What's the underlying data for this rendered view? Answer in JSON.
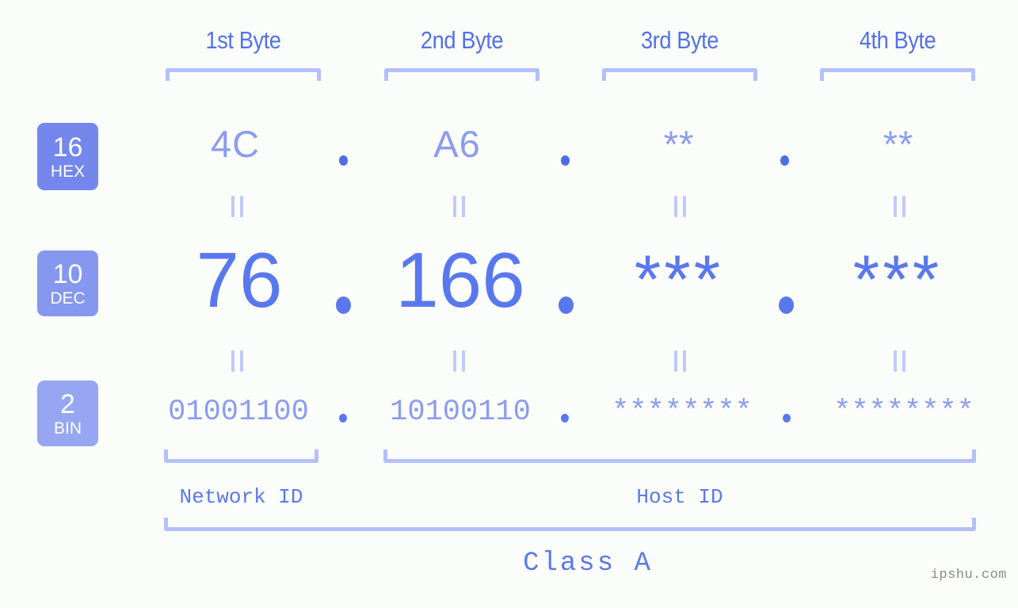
{
  "watermark": "ipshu.com",
  "class_label": "Class A",
  "byte_headers": [
    {
      "label": "1st Byte"
    },
    {
      "label": "2nd Byte"
    },
    {
      "label": "3rd Byte"
    },
    {
      "label": "4th Byte"
    }
  ],
  "bases": [
    {
      "id": "hex",
      "number": "16",
      "name": "HEX",
      "color": "#7387ec"
    },
    {
      "id": "dec",
      "number": "10",
      "name": "DEC",
      "color": "#8597ef"
    },
    {
      "id": "bin",
      "number": "2",
      "name": "BIN",
      "color": "#96a6f3"
    }
  ],
  "rows": {
    "hex": {
      "values": [
        "4C",
        "A6",
        "**",
        "**"
      ],
      "separator": "."
    },
    "dec": {
      "values": [
        "76",
        "166",
        "***",
        "***"
      ],
      "separator": "."
    },
    "bin": {
      "values": [
        "01001100",
        "10100110",
        "********",
        "********"
      ],
      "separator": "."
    }
  },
  "equals_mark": "=",
  "id_sections": [
    {
      "label": "Network ID"
    },
    {
      "label": "Host ID"
    }
  ],
  "colors": {
    "background": "#fbfdfa",
    "accent_strong": "#5a78ed",
    "accent_light": "#8b9cf0",
    "bracket": "#b4c0fb",
    "equals": "#bfcafc",
    "watermark": "#8b8b8b"
  }
}
